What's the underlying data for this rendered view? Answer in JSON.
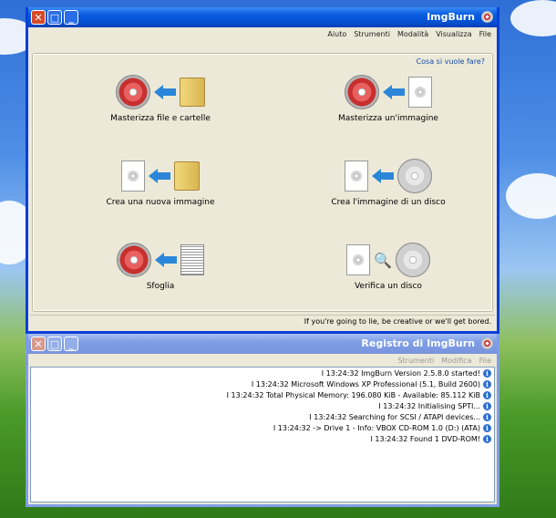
{
  "main": {
    "title": "ImgBurn",
    "menu": [
      "File",
      "Visualizza",
      "Modalità",
      "Strumenti",
      "Aiuto"
    ],
    "prompt": "Cosa si vuole fare?",
    "actions": [
      {
        "label": "Masterizza un'immagine"
      },
      {
        "label": "Masterizza file e cartelle"
      },
      {
        "label": "Crea l'immagine di un disco"
      },
      {
        "label": "Crea una nuova immagine"
      },
      {
        "label": "Verifica un disco"
      },
      {
        "label": "Sfoglia"
      }
    ],
    "status": "If you're going to lie, be creative or we'll get bored."
  },
  "log": {
    "title": "Registro di ImgBurn",
    "menu": [
      "File",
      "Modifica",
      "Strumenti"
    ],
    "lines": [
      "I 13:24:32 ImgBurn Version 2.5.8.0 started!",
      "I 13:24:32 Microsoft Windows XP Professional (5.1, Build 2600)",
      "I 13:24:32 Total Physical Memory: 196.080 KiB  -  Available: 85.112 KiB",
      "I 13:24:32 Initialising SPTI...",
      "I 13:24:32 Searching for SCSI / ATAPI devices...",
      "I 13:24:32 -> Drive 1 - Info: VBOX CD-ROM 1.0 (D:) (ATA)",
      "I 13:24:32 Found 1 DVD-ROM!"
    ]
  },
  "colors": {
    "accent": "#0553d6",
    "link": "#1a4fa8"
  }
}
